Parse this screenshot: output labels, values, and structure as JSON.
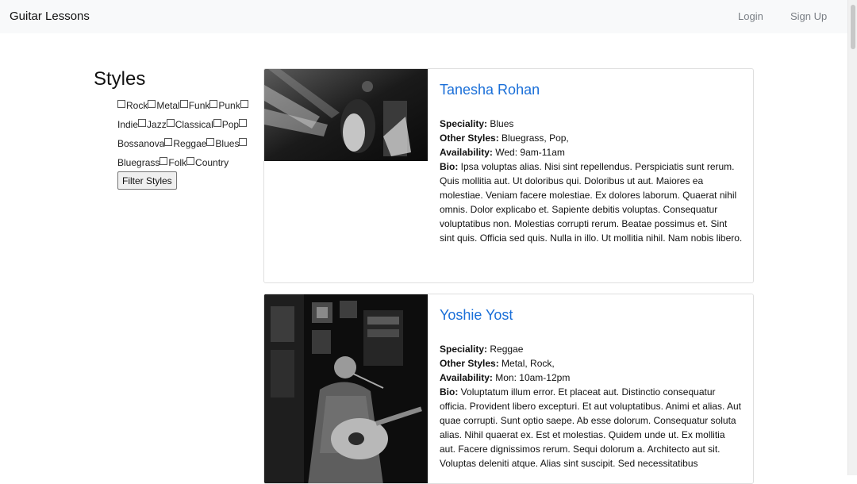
{
  "navbar": {
    "brand": "Guitar Lessons",
    "login": "Login",
    "signup": "Sign Up"
  },
  "sidebar": {
    "heading": "Styles",
    "styles": [
      "Rock",
      "Metal",
      "Funk",
      "Punk",
      "Indie",
      "Jazz",
      "Classical",
      "Pop",
      "Bossanova",
      "Reggae",
      "Blues",
      "Bluegrass",
      "Folk",
      "Country"
    ],
    "filter_button": "Filter Styles"
  },
  "labels": {
    "speciality": "Speciality:",
    "other_styles": "Other Styles:",
    "availability": "Availability:",
    "bio": "Bio:"
  },
  "teachers": [
    {
      "name": "Tanesha Rohan",
      "speciality": "Blues",
      "other_styles": "Bluegrass, Pop,",
      "availability": "Wed: 9am-11am",
      "bio": "Ipsa voluptas alias. Nisi sint repellendus. Perspiciatis sunt rerum. Quis mollitia aut. Ut doloribus qui. Doloribus ut aut. Maiores ea molestiae. Veniam facere molestiae. Ex dolores laborum. Quaerat nihil omnis. Dolor explicabo et. Sapiente debitis voluptas. Consequatur voluptatibus non. Molestias corrupti rerum. Beatae possimus et. Sint sint quis. Officia sed quis. Nulla in illo. Ut mollitia nihil. Nam nobis libero."
    },
    {
      "name": "Yoshie Yost",
      "speciality": "Reggae",
      "other_styles": "Metal, Rock,",
      "availability": "Mon: 10am-12pm",
      "bio": "Voluptatum illum error. Et placeat aut. Distinctio consequatur officia. Provident libero excepturi. Et aut voluptatibus. Animi et alias. Aut quae corrupti. Sunt optio saepe. Ab esse dolorum. Consequatur soluta alias. Nihil quaerat ex. Est et molestias. Quidem unde ut. Ex mollitia aut. Facere dignissimos rerum. Sequi dolorum a. Architecto aut sit. Voluptas deleniti atque. Alias sint suscipit. Sed necessitatibus"
    }
  ]
}
